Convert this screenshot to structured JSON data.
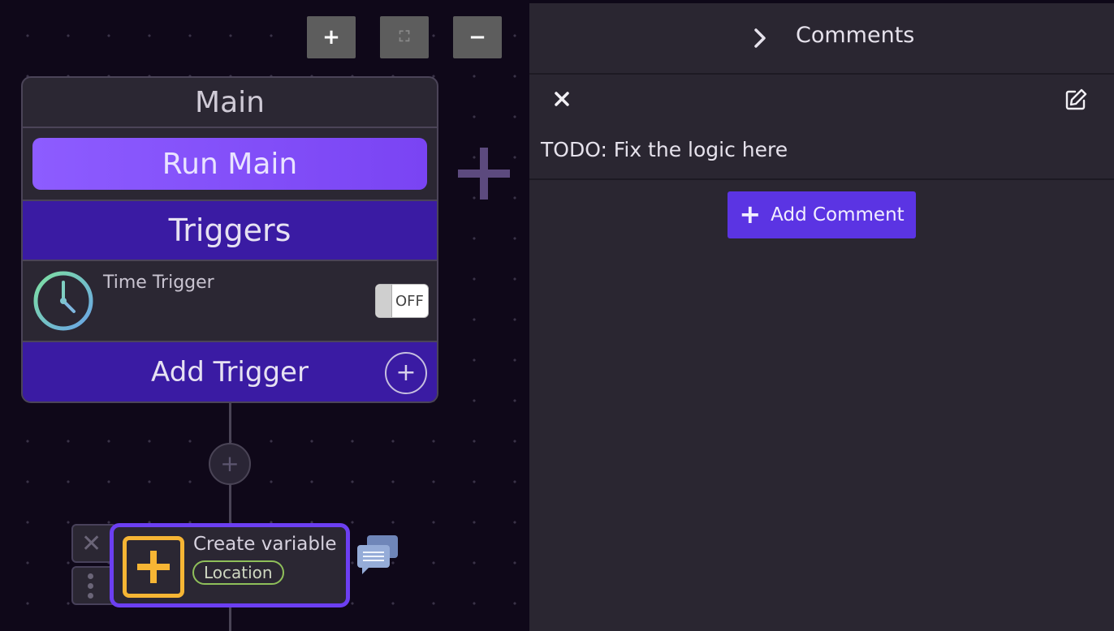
{
  "zoom_controls": {
    "zoom_in_glyph": "+",
    "fit_glyph": "⛶",
    "zoom_out_glyph": "−"
  },
  "main_node": {
    "title": "Main",
    "run_button_label": "Run Main",
    "triggers_heading": "Triggers",
    "trigger": {
      "name": "Time Trigger",
      "icon": "clock-icon",
      "toggle_state": "OFF"
    },
    "add_trigger_label": "Add Trigger",
    "add_trigger_glyph": "+"
  },
  "connector": {
    "add_step_glyph": "+"
  },
  "variable_node": {
    "title": "Create variable",
    "badge": "Location",
    "icon": "plus-square-icon",
    "close_glyph": "✕",
    "comment_icon": "comment-bubble-icon"
  },
  "comments_panel": {
    "title": "Comments",
    "comments": [
      {
        "text": "TODO: Fix the logic here"
      }
    ],
    "add_comment_glyph": "+",
    "add_comment_label": "Add Comment"
  },
  "colors": {
    "canvas_bg": "#0f0819",
    "node_bg": "#2b2733",
    "accent_purple": "#7a44f3",
    "trigger_bg": "#3a1ba3",
    "selection_border": "#6c3ff2",
    "variable_icon": "#f6b534",
    "badge_green": "#8fbf5a",
    "panel_bg": "#2a2631",
    "add_comment_bg": "#5b34e3"
  }
}
